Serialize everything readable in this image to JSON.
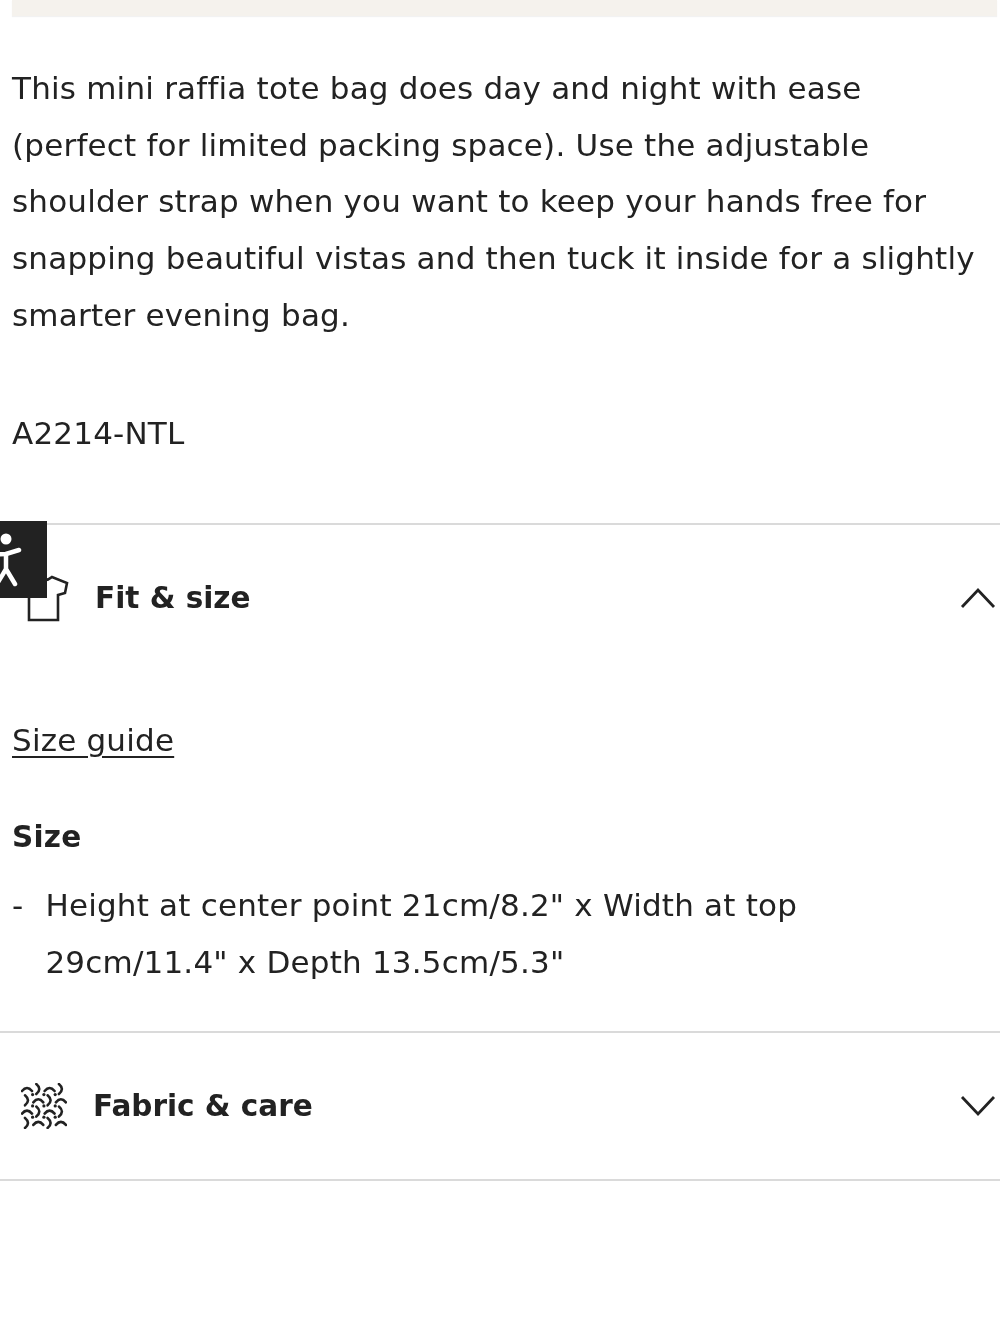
{
  "description": "This mini raffia tote bag does day and night with ease (perfect for limited packing space). Use the adjustable shoulder strap when you want to keep your hands free for snapping beautiful vistas and then tuck it inside for a slightly smarter evening bag.",
  "product_code": "A2214-NTL",
  "sections": [
    {
      "kind": "fit",
      "title": "Fit & size",
      "expanded": true,
      "link": "Size guide",
      "subheading": "Size",
      "list": [
        {
          "marker": "-",
          "text": "Height at center point 21cm/8.2\" x Width at top 29cm/11.4\" x Depth 13.5cm/5.3\""
        }
      ]
    },
    {
      "kind": "fabric",
      "title": "Fabric & care",
      "expanded": false
    }
  ]
}
